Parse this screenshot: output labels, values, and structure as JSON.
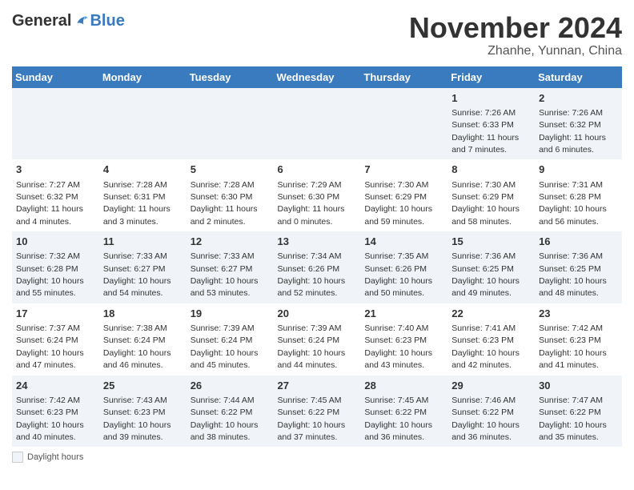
{
  "header": {
    "logo_general": "General",
    "logo_blue": "Blue",
    "month_title": "November 2024",
    "subtitle": "Zhanhe, Yunnan, China"
  },
  "weekdays": [
    "Sunday",
    "Monday",
    "Tuesday",
    "Wednesday",
    "Thursday",
    "Friday",
    "Saturday"
  ],
  "weeks": [
    [
      {
        "day": "",
        "info": ""
      },
      {
        "day": "",
        "info": ""
      },
      {
        "day": "",
        "info": ""
      },
      {
        "day": "",
        "info": ""
      },
      {
        "day": "",
        "info": ""
      },
      {
        "day": "1",
        "info": "Sunrise: 7:26 AM\nSunset: 6:33 PM\nDaylight: 11 hours\nand 7 minutes."
      },
      {
        "day": "2",
        "info": "Sunrise: 7:26 AM\nSunset: 6:32 PM\nDaylight: 11 hours\nand 6 minutes."
      }
    ],
    [
      {
        "day": "3",
        "info": "Sunrise: 7:27 AM\nSunset: 6:32 PM\nDaylight: 11 hours\nand 4 minutes."
      },
      {
        "day": "4",
        "info": "Sunrise: 7:28 AM\nSunset: 6:31 PM\nDaylight: 11 hours\nand 3 minutes."
      },
      {
        "day": "5",
        "info": "Sunrise: 7:28 AM\nSunset: 6:30 PM\nDaylight: 11 hours\nand 2 minutes."
      },
      {
        "day": "6",
        "info": "Sunrise: 7:29 AM\nSunset: 6:30 PM\nDaylight: 11 hours\nand 0 minutes."
      },
      {
        "day": "7",
        "info": "Sunrise: 7:30 AM\nSunset: 6:29 PM\nDaylight: 10 hours\nand 59 minutes."
      },
      {
        "day": "8",
        "info": "Sunrise: 7:30 AM\nSunset: 6:29 PM\nDaylight: 10 hours\nand 58 minutes."
      },
      {
        "day": "9",
        "info": "Sunrise: 7:31 AM\nSunset: 6:28 PM\nDaylight: 10 hours\nand 56 minutes."
      }
    ],
    [
      {
        "day": "10",
        "info": "Sunrise: 7:32 AM\nSunset: 6:28 PM\nDaylight: 10 hours\nand 55 minutes."
      },
      {
        "day": "11",
        "info": "Sunrise: 7:33 AM\nSunset: 6:27 PM\nDaylight: 10 hours\nand 54 minutes."
      },
      {
        "day": "12",
        "info": "Sunrise: 7:33 AM\nSunset: 6:27 PM\nDaylight: 10 hours\nand 53 minutes."
      },
      {
        "day": "13",
        "info": "Sunrise: 7:34 AM\nSunset: 6:26 PM\nDaylight: 10 hours\nand 52 minutes."
      },
      {
        "day": "14",
        "info": "Sunrise: 7:35 AM\nSunset: 6:26 PM\nDaylight: 10 hours\nand 50 minutes."
      },
      {
        "day": "15",
        "info": "Sunrise: 7:36 AM\nSunset: 6:25 PM\nDaylight: 10 hours\nand 49 minutes."
      },
      {
        "day": "16",
        "info": "Sunrise: 7:36 AM\nSunset: 6:25 PM\nDaylight: 10 hours\nand 48 minutes."
      }
    ],
    [
      {
        "day": "17",
        "info": "Sunrise: 7:37 AM\nSunset: 6:24 PM\nDaylight: 10 hours\nand 47 minutes."
      },
      {
        "day": "18",
        "info": "Sunrise: 7:38 AM\nSunset: 6:24 PM\nDaylight: 10 hours\nand 46 minutes."
      },
      {
        "day": "19",
        "info": "Sunrise: 7:39 AM\nSunset: 6:24 PM\nDaylight: 10 hours\nand 45 minutes."
      },
      {
        "day": "20",
        "info": "Sunrise: 7:39 AM\nSunset: 6:24 PM\nDaylight: 10 hours\nand 44 minutes."
      },
      {
        "day": "21",
        "info": "Sunrise: 7:40 AM\nSunset: 6:23 PM\nDaylight: 10 hours\nand 43 minutes."
      },
      {
        "day": "22",
        "info": "Sunrise: 7:41 AM\nSunset: 6:23 PM\nDaylight: 10 hours\nand 42 minutes."
      },
      {
        "day": "23",
        "info": "Sunrise: 7:42 AM\nSunset: 6:23 PM\nDaylight: 10 hours\nand 41 minutes."
      }
    ],
    [
      {
        "day": "24",
        "info": "Sunrise: 7:42 AM\nSunset: 6:23 PM\nDaylight: 10 hours\nand 40 minutes."
      },
      {
        "day": "25",
        "info": "Sunrise: 7:43 AM\nSunset: 6:23 PM\nDaylight: 10 hours\nand 39 minutes."
      },
      {
        "day": "26",
        "info": "Sunrise: 7:44 AM\nSunset: 6:22 PM\nDaylight: 10 hours\nand 38 minutes."
      },
      {
        "day": "27",
        "info": "Sunrise: 7:45 AM\nSunset: 6:22 PM\nDaylight: 10 hours\nand 37 minutes."
      },
      {
        "day": "28",
        "info": "Sunrise: 7:45 AM\nSunset: 6:22 PM\nDaylight: 10 hours\nand 36 minutes."
      },
      {
        "day": "29",
        "info": "Sunrise: 7:46 AM\nSunset: 6:22 PM\nDaylight: 10 hours\nand 36 minutes."
      },
      {
        "day": "30",
        "info": "Sunrise: 7:47 AM\nSunset: 6:22 PM\nDaylight: 10 hours\nand 35 minutes."
      }
    ]
  ],
  "legend": {
    "box_label": "Daylight hours"
  }
}
